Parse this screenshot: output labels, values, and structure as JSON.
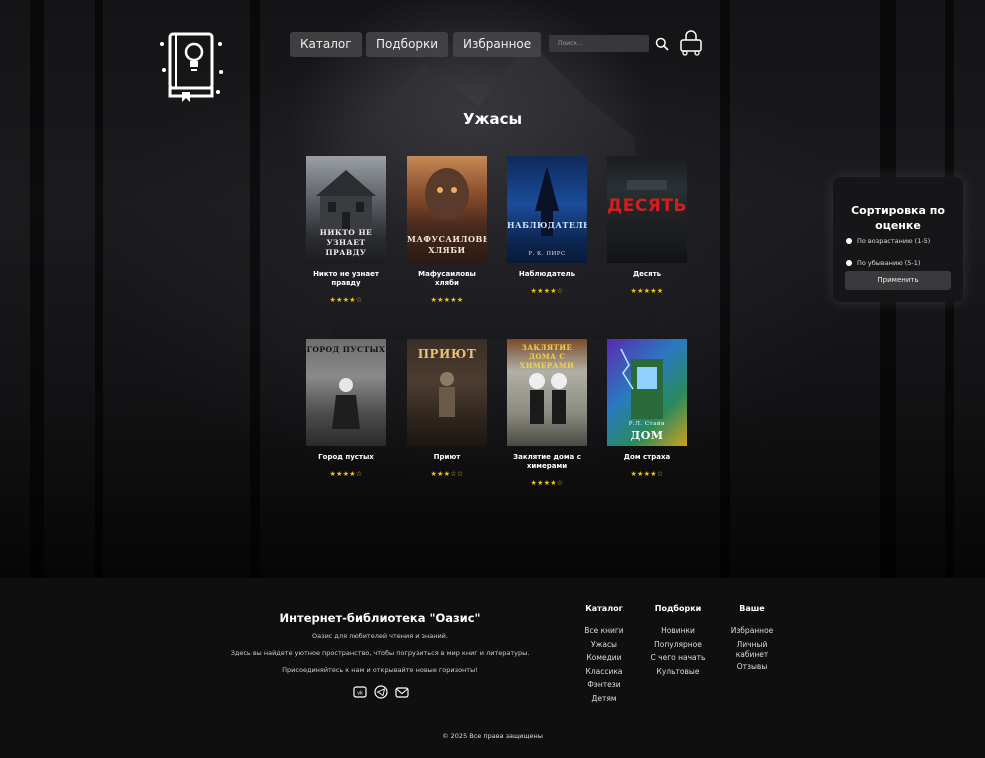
{
  "header": {
    "nav": [
      {
        "label": "Каталог"
      },
      {
        "label": "Подборки"
      },
      {
        "label": "Избранное"
      }
    ],
    "search": {
      "placeholder": "Поиск..."
    }
  },
  "page_title": "Ужасы",
  "books": [
    {
      "title": "Никто не узнает правду",
      "rating": "★★★★☆",
      "cover_text": "НИКТО НЕ УЗНАЕТ ПРАВДУ"
    },
    {
      "title": "Мафусаиловы хляби",
      "rating": "★★★★★",
      "cover_text": "МАФУСАИЛОВЫ ХЛЯБИ"
    },
    {
      "title": "Наблюдатель",
      "rating": "★★★★☆",
      "cover_text": "НАБЛЮДАТЕЛЬ",
      "cover_author": "Р. К. ПИРС"
    },
    {
      "title": "Десять",
      "rating": "★★★★★",
      "cover_text": "ДЕСЯТЬ"
    },
    {
      "title": "Город пустых",
      "rating": "★★★★☆",
      "cover_text": "ГОРОД ПУСТЫХ"
    },
    {
      "title": "Приют",
      "rating": "★★★☆☆",
      "cover_text": "ПРИЮТ"
    },
    {
      "title": "Заклятие дома с химерами",
      "rating": "★★★★☆",
      "cover_text": "ЗАКЛЯТИЕ ДОМА С ХИМЕРАМИ"
    },
    {
      "title": "Дом страха",
      "rating": "★★★★☆",
      "cover_text": "ДОМ",
      "cover_author": "Р.Л. Стайн"
    }
  ],
  "sort": {
    "title": "Сортировка по оценке",
    "options": [
      {
        "label": "По возрастанию (1-5)"
      },
      {
        "label": "По убыванию (5-1)"
      }
    ],
    "apply": "Применить"
  },
  "footer": {
    "title": "Интернет-библиотека \"Оазис\"",
    "lines": [
      "Оазис для любителей чтения и знаний.",
      "Здесь вы найдете уютное пространство, чтобы погрузиться в мир книг и литературы.",
      "Присоединяйтесь к нам и открывайте новые горизонты!"
    ],
    "columns": [
      {
        "heading": "Каталог",
        "items": [
          "Все книги",
          "Ужасы",
          "Комедии",
          "Классика",
          "Фэнтези",
          "Детям"
        ]
      },
      {
        "heading": "Подборки",
        "items": [
          "Новинки",
          "Популярное",
          "С чего начать",
          "Культовые"
        ]
      },
      {
        "heading": "Ваше",
        "items": [
          "Избранное",
          "Личный",
          "кабинет",
          "Отзывы"
        ]
      }
    ],
    "copyright": "© 2025 Все права защищены"
  }
}
